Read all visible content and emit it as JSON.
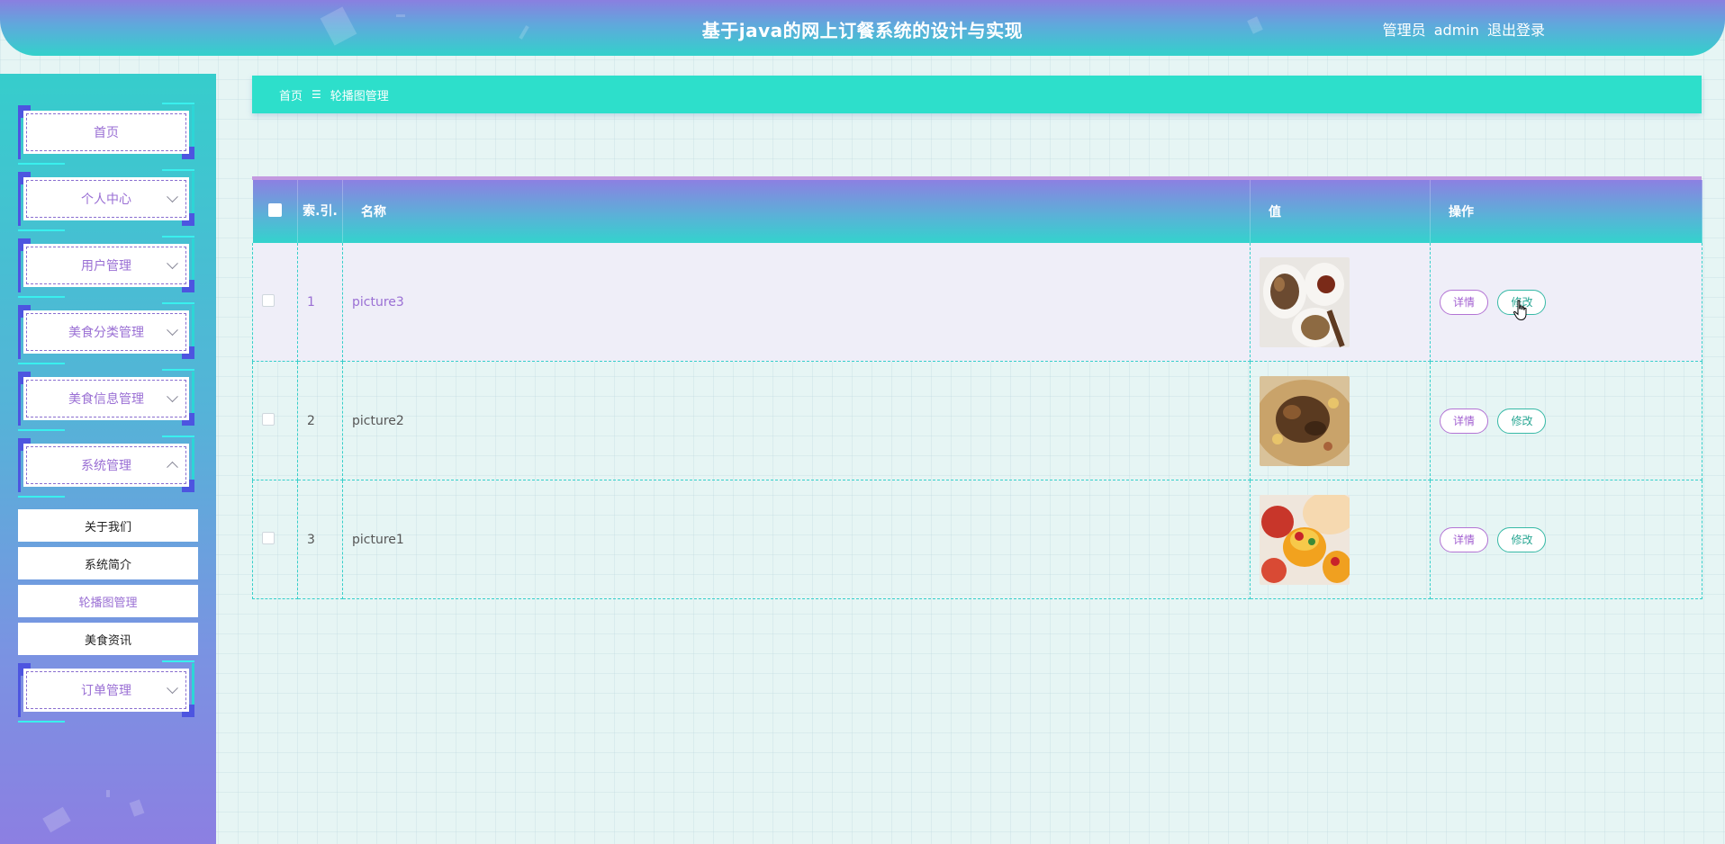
{
  "header": {
    "title": "基于java的网上订餐系统的设计与实现",
    "user_role": "管理员",
    "user_name": "admin",
    "logout_label": "退出登录"
  },
  "sidebar": {
    "items": [
      {
        "label": "首页",
        "has_arrow": false
      },
      {
        "label": "个人中心",
        "has_arrow": true
      },
      {
        "label": "用户管理",
        "has_arrow": true
      },
      {
        "label": "美食分类管理",
        "has_arrow": true
      },
      {
        "label": "美食信息管理",
        "has_arrow": true
      },
      {
        "label": "系统管理",
        "has_arrow": true,
        "expanded": true
      },
      {
        "label": "订单管理",
        "has_arrow": true
      }
    ],
    "sub_items": [
      {
        "label": "关于我们"
      },
      {
        "label": "系统简介"
      },
      {
        "label": "轮播图管理",
        "active": true
      },
      {
        "label": "美食资讯"
      }
    ]
  },
  "breadcrumb": {
    "home": "首页",
    "separator": "☰",
    "current": "轮播图管理"
  },
  "table": {
    "headers": {
      "index": "索.引.",
      "name": "名称",
      "value": "值",
      "action": "操作"
    },
    "rows": [
      {
        "index": "1",
        "name": "picture3",
        "detail": "详情",
        "edit": "修改"
      },
      {
        "index": "2",
        "name": "picture2",
        "detail": "详情",
        "edit": "修改"
      },
      {
        "index": "3",
        "name": "picture1",
        "detail": "详情",
        "edit": "修改"
      }
    ]
  },
  "colors": {
    "accent_teal": "#2ddfcb",
    "accent_purple": "#8c80e2",
    "detail_button": "#a25fd0",
    "edit_button": "#2aa794"
  }
}
